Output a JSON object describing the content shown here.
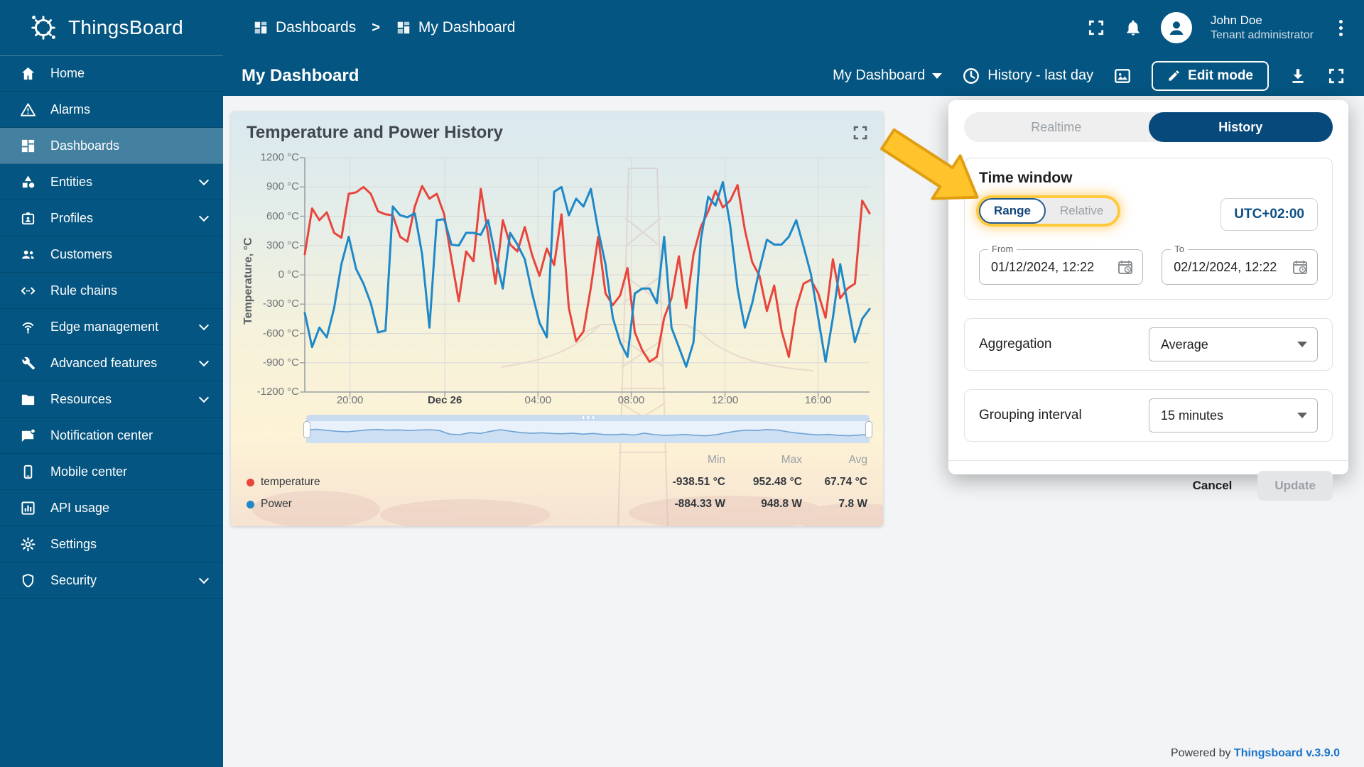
{
  "topbar": {
    "logo_text": "ThingsBoard",
    "breadcrumb": {
      "level1": "Dashboards",
      "separator": ">",
      "level2": "My Dashboard"
    },
    "user": {
      "name": "John Doe",
      "role": "Tenant administrator"
    }
  },
  "toolbar": {
    "title": "My Dashboard",
    "dashboard_select": "My Dashboard",
    "time_label": "History - last day",
    "edit_label": "Edit mode"
  },
  "sidebar": {
    "items": [
      {
        "label": "Home",
        "icon": "home-icon",
        "expandable": false,
        "active": false
      },
      {
        "label": "Alarms",
        "icon": "alarm-warning-icon",
        "expandable": false,
        "active": false
      },
      {
        "label": "Dashboards",
        "icon": "dashboards-grid-icon",
        "expandable": false,
        "active": true
      },
      {
        "label": "Entities",
        "icon": "entities-shapes-icon",
        "expandable": true,
        "active": false
      },
      {
        "label": "Profiles",
        "icon": "profiles-badge-icon",
        "expandable": true,
        "active": false
      },
      {
        "label": "Customers",
        "icon": "customers-people-icon",
        "expandable": false,
        "active": false
      },
      {
        "label": "Rule chains",
        "icon": "rule-chains-icon",
        "expandable": false,
        "active": false
      },
      {
        "label": "Edge management",
        "icon": "edge-antenna-icon",
        "expandable": true,
        "active": false
      },
      {
        "label": "Advanced features",
        "icon": "advanced-tools-icon",
        "expandable": true,
        "active": false
      },
      {
        "label": "Resources",
        "icon": "resources-folder-icon",
        "expandable": true,
        "active": false
      },
      {
        "label": "Notification center",
        "icon": "notification-message-icon",
        "expandable": false,
        "active": false
      },
      {
        "label": "Mobile center",
        "icon": "mobile-phone-icon",
        "expandable": false,
        "active": false
      },
      {
        "label": "API usage",
        "icon": "api-chart-icon",
        "expandable": false,
        "active": false
      },
      {
        "label": "Settings",
        "icon": "settings-gear-icon",
        "expandable": false,
        "active": false
      },
      {
        "label": "Security",
        "icon": "security-shield-icon",
        "expandable": true,
        "active": false
      }
    ]
  },
  "widget": {
    "title": "Temperature and Power History"
  },
  "chart_data": {
    "type": "line",
    "title": "Temperature and Power History",
    "ylabel": "Temperature, °C",
    "ylim": [
      -1200,
      1200
    ],
    "ytick_step": 300,
    "yticks": [
      "1200 °C",
      "900 °C",
      "600 °C",
      "300 °C",
      "0 °C",
      "-300 °C",
      "-600 °C",
      "-900 °C",
      "-1200 °C"
    ],
    "xticks": [
      {
        "label": "20:00",
        "pos": 0.08,
        "bold": false
      },
      {
        "label": "Dec 26",
        "pos": 0.248,
        "bold": true
      },
      {
        "label": "04:00",
        "pos": 0.413,
        "bold": false
      },
      {
        "label": "08:00",
        "pos": 0.578,
        "bold": false
      },
      {
        "label": "12:00",
        "pos": 0.744,
        "bold": false
      },
      {
        "label": "16:00",
        "pos": 0.909,
        "bold": false
      }
    ],
    "grid": true,
    "legend_position": "bottom",
    "series": [
      {
        "name": "temperature",
        "unit": "°C",
        "color": "#e8453c",
        "values": [
          210,
          680,
          560,
          640,
          430,
          380,
          830,
          845,
          900,
          830,
          650,
          620,
          610,
          390,
          340,
          700,
          910,
          780,
          830,
          620,
          160,
          -270,
          240,
          140,
          880,
          410,
          -90,
          560,
          310,
          240,
          490,
          200,
          -10,
          270,
          100,
          620,
          -340,
          -680,
          -580,
          -130,
          390,
          -190,
          -310,
          -210,
          70,
          -590,
          -770,
          -890,
          -840,
          -440,
          -240,
          190,
          -340,
          210,
          490,
          650,
          860,
          690,
          760,
          920,
          460,
          130,
          -10,
          -370,
          -110,
          -570,
          -840,
          -340,
          -90,
          -50,
          -190,
          -440,
          160,
          -240,
          -140,
          -90,
          760,
          630
        ]
      },
      {
        "name": "Power",
        "unit": "W",
        "color": "#1e88c9",
        "values": [
          -390,
          -740,
          -540,
          -640,
          -340,
          110,
          390,
          60,
          -90,
          -290,
          -590,
          -570,
          700,
          610,
          590,
          630,
          210,
          -540,
          560,
          570,
          310,
          300,
          430,
          430,
          410,
          560,
          190,
          -140,
          430,
          310,
          160,
          -190,
          -490,
          -640,
          850,
          900,
          610,
          780,
          700,
          880,
          460,
          110,
          -440,
          -690,
          -840,
          -190,
          -140,
          -140,
          -290,
          390,
          -540,
          -740,
          -940,
          -690,
          360,
          800,
          710,
          950,
          510,
          -140,
          -540,
          -290,
          60,
          360,
          310,
          310,
          390,
          560,
          290,
          10,
          -440,
          -890,
          -440,
          110,
          -290,
          -690,
          -450,
          -350
        ]
      }
    ],
    "navigator": [
      0.62,
      0.68,
      0.61,
      0.55,
      0.52,
      0.58,
      0.64,
      0.66,
      0.62,
      0.64,
      0.6,
      0.63,
      0.65,
      0.6,
      0.38,
      0.35,
      0.47,
      0.42,
      0.55,
      0.65,
      0.55,
      0.47,
      0.43,
      0.46,
      0.42,
      0.4,
      0.44,
      0.38,
      0.42,
      0.36,
      0.34,
      0.38,
      0.32,
      0.44,
      0.35,
      0.3,
      0.32,
      0.36,
      0.3,
      0.28,
      0.34,
      0.46,
      0.56,
      0.62,
      0.6,
      0.66,
      0.63,
      0.52,
      0.44,
      0.38,
      0.33,
      0.36,
      0.3,
      0.28,
      0.32,
      0.36
    ],
    "stats": {
      "headers": [
        "Min",
        "Max",
        "Avg"
      ],
      "rows": [
        {
          "name": "temperature",
          "min": "-938.51 °C",
          "max": "952.48 °C",
          "avg": "67.74 °C"
        },
        {
          "name": "Power",
          "min": "-884.33 W",
          "max": "948.8 W",
          "avg": "7.8 W"
        }
      ]
    }
  },
  "popup": {
    "tabs": {
      "realtime": "Realtime",
      "history": "History"
    },
    "time_window": {
      "heading": "Time window",
      "range_label": "Range",
      "relative_label": "Relative",
      "timezone": "UTC+02:00",
      "from_label": "From",
      "from_value": "01/12/2024, 12:22",
      "to_label": "To",
      "to_value": "02/12/2024, 12:22"
    },
    "aggregation": {
      "label": "Aggregation",
      "value": "Average"
    },
    "grouping": {
      "label": "Grouping interval",
      "value": "15 minutes"
    },
    "cancel_label": "Cancel",
    "update_label": "Update"
  },
  "footer": {
    "powered_by": "Powered by",
    "version_link": "Thingsboard v.3.9.0"
  },
  "colors": {
    "primary": "#045581",
    "series_red": "#e8453c",
    "series_blue": "#1e88c9",
    "highlight": "#ffc107"
  }
}
